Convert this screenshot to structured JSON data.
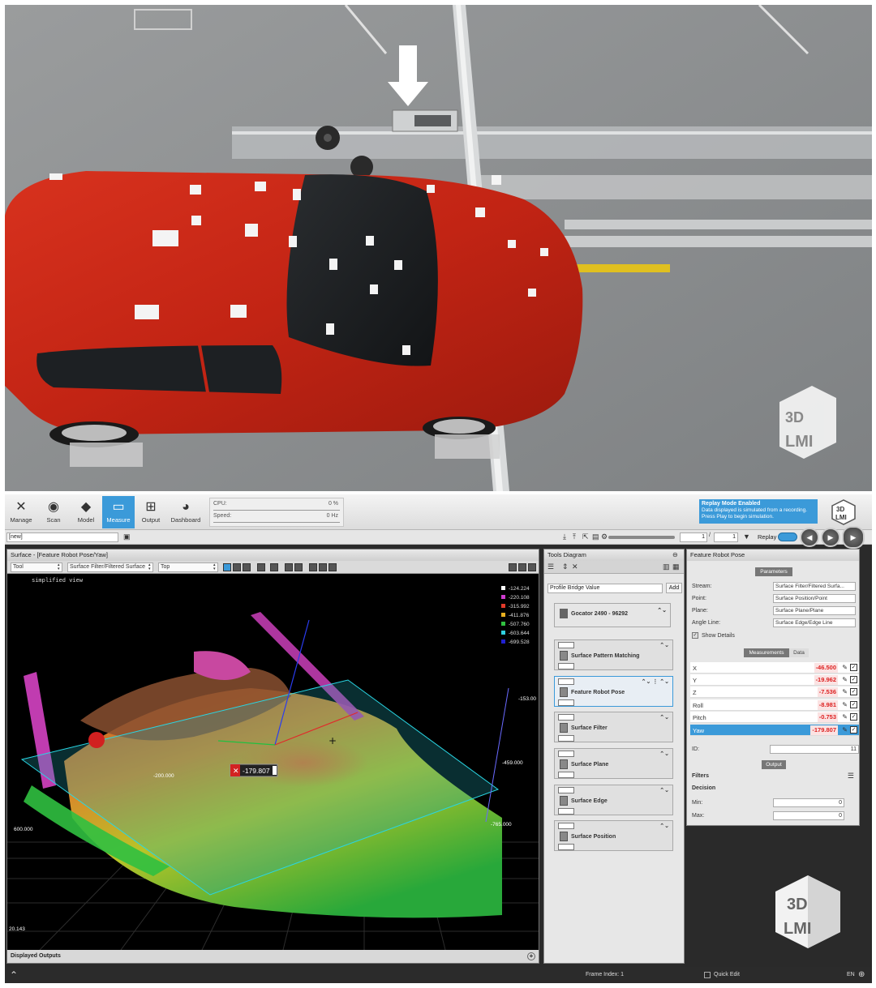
{
  "photo": {
    "watermark": "3D LMI",
    "description_icon": "down-arrow-icon"
  },
  "nav": [
    {
      "label": "Manage",
      "icon": "wrench-icon"
    },
    {
      "label": "Scan",
      "icon": "scan-icon"
    },
    {
      "label": "Model",
      "icon": "model-icon"
    },
    {
      "label": "Measure",
      "icon": "measure-icon",
      "active": true
    },
    {
      "label": "Output",
      "icon": "output-icon"
    },
    {
      "label": "Dashboard",
      "icon": "dashboard-icon"
    }
  ],
  "meters": {
    "cpu_label": "CPU:",
    "cpu_value": "0 %",
    "speed_label": "Speed:",
    "speed_value": "0 Hz"
  },
  "replay_banner": {
    "title": "Replay Mode Enabled",
    "text": "Data displayed is simulated from a recording. Press Play to begin simulation."
  },
  "subbar": {
    "job": "[new]",
    "frame_value": "1",
    "frame_total": "1",
    "replay_label": "Replay"
  },
  "view": {
    "title": "Surface - [Feature Robot Pose/Yaw]",
    "dropdown_tool": "Tool",
    "dropdown_stream": "Surface Filter/Filtered Surface",
    "dropdown_view": "Top",
    "overlay_text": "simplified view",
    "legend": [
      {
        "color": "#ffffff",
        "value": "-124.224"
      },
      {
        "color": "#d03cd0",
        "value": "-220.108"
      },
      {
        "color": "#e23a2a",
        "value": "-315.992"
      },
      {
        "color": "#e8b020",
        "value": "-411.876"
      },
      {
        "color": "#30c040",
        "value": "-507.760"
      },
      {
        "color": "#30d0e0",
        "value": "-603.644"
      },
      {
        "color": "#2020d0",
        "value": "-699.528"
      }
    ],
    "axis_labels": [
      {
        "text": "-153.00"
      },
      {
        "text": "-459.000"
      },
      {
        "text": "-765.000"
      },
      {
        "text": "600.000"
      },
      {
        "text": "-200.000"
      },
      {
        "text": "20.143"
      }
    ],
    "tooltip_value": "-179.807",
    "bottom_label": "Displayed Outputs"
  },
  "tools": {
    "title": "Tools Diagram",
    "bridge": "Profile Bridge Value",
    "add_label": "Add",
    "sensor": "Gocator 2490 - 96292",
    "items": [
      {
        "name": "Surface Pattern Matching"
      },
      {
        "name": "Feature Robot Pose"
      },
      {
        "name": "Surface Filter"
      },
      {
        "name": "Surface Plane"
      },
      {
        "name": "Surface Edge"
      },
      {
        "name": "Surface Position"
      }
    ]
  },
  "props": {
    "title": "Feature Robot Pose",
    "params_tab": "Parameters",
    "params": [
      {
        "label": "Stream:",
        "value": "Surface Filter/Filtered Surfa..."
      },
      {
        "label": "Point:",
        "value": "Surface Position/Point"
      },
      {
        "label": "Plane:",
        "value": "Surface Plane/Plane"
      },
      {
        "label": "Angle Line:",
        "value": "Surface Edge/Edge Line"
      }
    ],
    "show_details": "Show Details",
    "tab_measurements": "Measurements",
    "tab_data": "Data",
    "measurements": [
      {
        "label": "X",
        "value": "-46.500"
      },
      {
        "label": "Y",
        "value": "-19.962"
      },
      {
        "label": "Z",
        "value": "-7.536"
      },
      {
        "label": "Roll",
        "value": "-8.981"
      },
      {
        "label": "Pitch",
        "value": "-0.753"
      },
      {
        "label": "Yaw",
        "value": "-179.807"
      }
    ],
    "id_label": "ID:",
    "id_value": "11",
    "output_tab": "Output",
    "filters_label": "Filters",
    "decision_label": "Decision",
    "min_label": "Min:",
    "min_value": "0",
    "max_label": "Max:",
    "max_value": "0"
  },
  "status": {
    "frame_index": "Frame Index: 1",
    "quick_edit": "Quick Edit",
    "lang": "EN"
  },
  "colors": {
    "accent": "#3b9ad9",
    "error": "#d22222"
  }
}
